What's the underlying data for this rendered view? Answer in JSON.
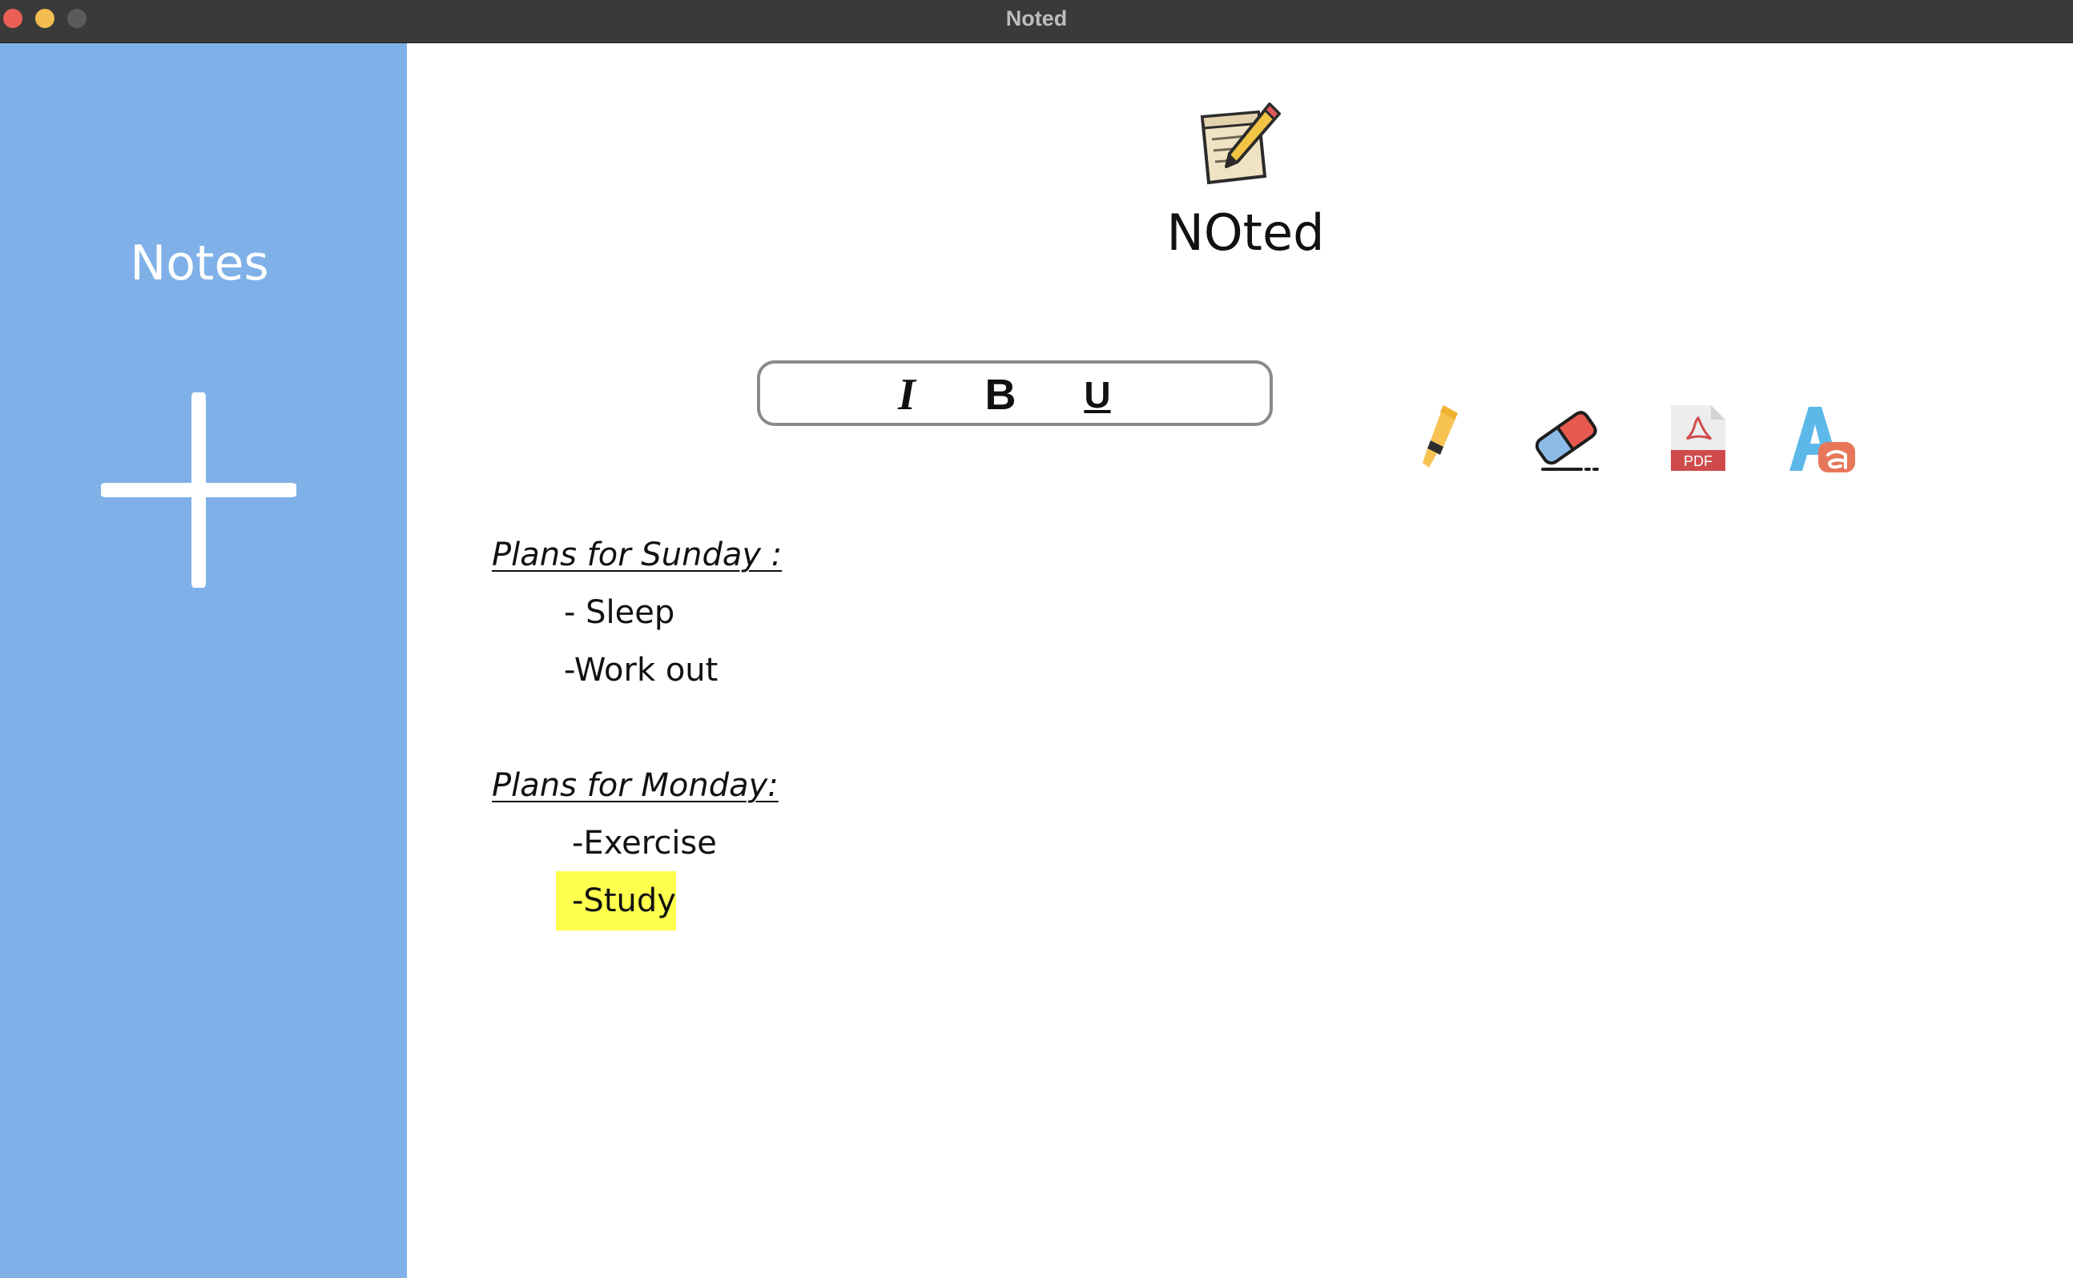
{
  "window": {
    "title": "Noted"
  },
  "sidebar": {
    "title": "Notes",
    "add_icon": "plus-icon",
    "background": "#7fb1e8"
  },
  "header": {
    "logo_icon": "notepad-pencil-icon",
    "app_name": "NOted"
  },
  "toolbar": {
    "italic_label": "I",
    "bold_label": "B",
    "underline_label": "U",
    "tools": [
      {
        "name": "highlighter",
        "icon": "highlighter-icon"
      },
      {
        "name": "eraser",
        "icon": "eraser-icon"
      },
      {
        "name": "pdf",
        "icon": "pdf-icon",
        "label": "PDF"
      },
      {
        "name": "font-color",
        "icon": "font-color-icon"
      }
    ]
  },
  "note": {
    "sections": [
      {
        "heading": "Plans for Sunday :",
        "items": [
          "- Sleep",
          "-Work out"
        ]
      },
      {
        "heading": "Plans for Monday:",
        "items": [
          "-Exercise",
          "-Study"
        ]
      }
    ],
    "highlight_color": "#ffff4d"
  }
}
